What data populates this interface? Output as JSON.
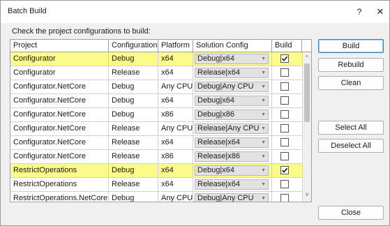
{
  "window": {
    "title": "Batch Build",
    "help_glyph": "?",
    "close_glyph": "✕"
  },
  "instruction": "Check the project configurations to build:",
  "columns": [
    "Project",
    "Configuration",
    "Platform",
    "Solution Config",
    "Build"
  ],
  "rows": [
    {
      "project": "Configurator",
      "configuration": "Debug",
      "platform": "x64",
      "solution_config": "Debug|x64",
      "build": true,
      "highlighted": true
    },
    {
      "project": "Configurator",
      "configuration": "Release",
      "platform": "x64",
      "solution_config": "Release|x64",
      "build": false,
      "highlighted": false
    },
    {
      "project": "Configurator.NetCore",
      "configuration": "Debug",
      "platform": "Any CPU",
      "solution_config": "Debug|Any CPU",
      "build": false,
      "highlighted": false
    },
    {
      "project": "Configurator.NetCore",
      "configuration": "Debug",
      "platform": "x64",
      "solution_config": "Debug|x64",
      "build": false,
      "highlighted": false
    },
    {
      "project": "Configurator.NetCore",
      "configuration": "Debug",
      "platform": "x86",
      "solution_config": "Debug|x86",
      "build": false,
      "highlighted": false
    },
    {
      "project": "Configurator.NetCore",
      "configuration": "Release",
      "platform": "Any CPU",
      "solution_config": "Release|Any CPU",
      "build": false,
      "highlighted": false
    },
    {
      "project": "Configurator.NetCore",
      "configuration": "Release",
      "platform": "x64",
      "solution_config": "Release|x64",
      "build": false,
      "highlighted": false
    },
    {
      "project": "Configurator.NetCore",
      "configuration": "Release",
      "platform": "x86",
      "solution_config": "Release|x86",
      "build": false,
      "highlighted": false
    },
    {
      "project": "RestrictOperations",
      "configuration": "Debug",
      "platform": "x64",
      "solution_config": "Debug|x64",
      "build": true,
      "highlighted": true
    },
    {
      "project": "RestrictOperations",
      "configuration": "Release",
      "platform": "x64",
      "solution_config": "Release|x64",
      "build": false,
      "highlighted": false
    },
    {
      "project": "RestrictOperations.NetCore",
      "configuration": "Debug",
      "platform": "Any CPU",
      "solution_config": "Debug|Any CPU",
      "build": false,
      "highlighted": false
    }
  ],
  "buttons": {
    "build": "Build",
    "rebuild": "Rebuild",
    "clean": "Clean",
    "select_all": "Select All",
    "deselect_all": "Deselect All",
    "close": "Close"
  },
  "colors": {
    "highlight": "#fbfb8c",
    "check": "#1a1a1a"
  },
  "scrollbar": {
    "up_glyph": "^",
    "down_glyph": "v"
  },
  "icons": {
    "combo_arrow": "chevron-down-icon",
    "check": "checkmark-icon"
  }
}
